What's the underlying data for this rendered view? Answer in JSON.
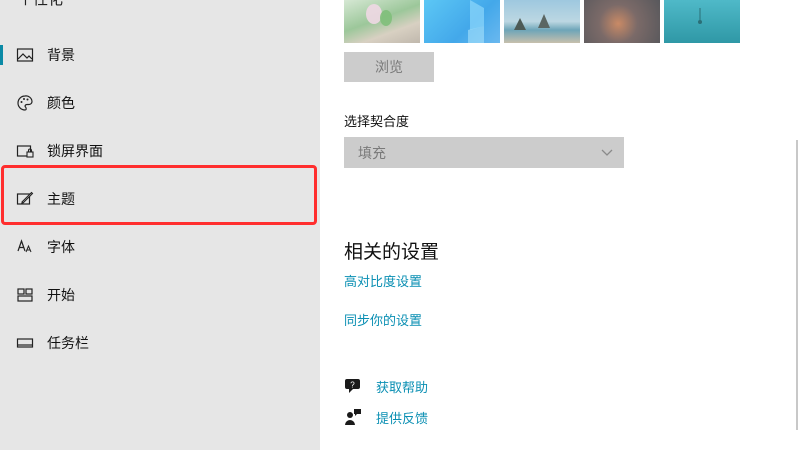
{
  "window": {
    "title_partial": "个性化"
  },
  "sidebar": {
    "items": [
      {
        "label": "背景",
        "icon": "picture-icon",
        "active": true
      },
      {
        "label": "颜色",
        "icon": "palette-icon",
        "active": false
      },
      {
        "label": "锁屏界面",
        "icon": "lock-screen-icon",
        "active": false
      },
      {
        "label": "主题",
        "icon": "theme-brush-icon",
        "active": false
      },
      {
        "label": "字体",
        "icon": "font-icon",
        "active": false
      },
      {
        "label": "开始",
        "icon": "start-menu-icon",
        "active": false
      },
      {
        "label": "任务栏",
        "icon": "taskbar-icon",
        "active": false
      }
    ],
    "highlighted_item": "主题"
  },
  "main": {
    "wallpapers": [
      "wallpaper-1",
      "wallpaper-2",
      "wallpaper-3",
      "wallpaper-4",
      "wallpaper-5"
    ],
    "browse_label": "浏览",
    "fit": {
      "label": "选择契合度",
      "value": "填充"
    },
    "related": {
      "title": "相关的设置",
      "links": [
        "高对比度设置",
        "同步你的设置"
      ]
    },
    "help": {
      "get_help": "获取帮助",
      "feedback": "提供反馈"
    }
  },
  "colors": {
    "accent": "#0a8fb3",
    "sidebar_bg": "#e6e6e6",
    "highlight": "#ff2e2e",
    "disabled_bg": "#cccccc"
  }
}
